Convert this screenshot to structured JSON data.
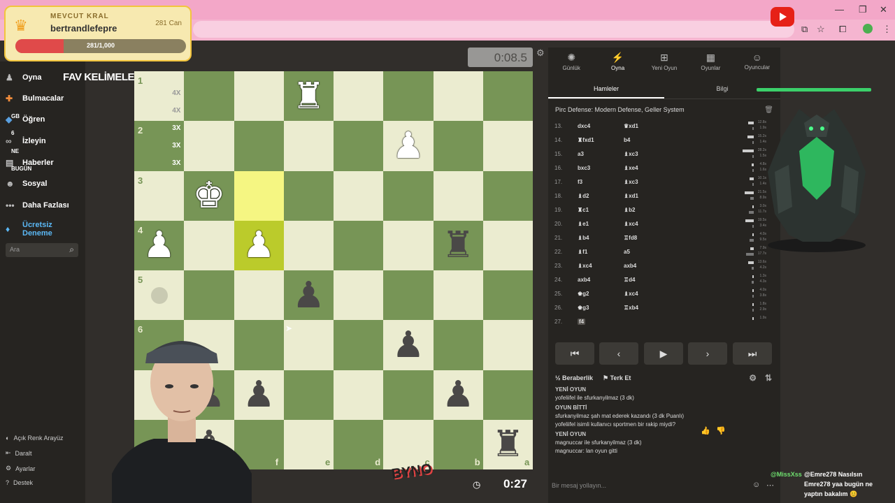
{
  "overlay_king": {
    "label": "MEVCUT KRAL",
    "name": "bertrandlefepre",
    "hp_label": "281 Can",
    "progress_text": "281/1,000",
    "progress_fraction": 0.281
  },
  "sidebar": {
    "items": [
      {
        "label": "Oyna",
        "icon": "pawn-icon"
      },
      {
        "label": "Bulmacalar",
        "icon": "puzzle-icon"
      },
      {
        "label": "Öğren",
        "icon": "learn-icon"
      },
      {
        "label": "İzleyin",
        "icon": "binoculars-icon"
      },
      {
        "label": "Haberler",
        "icon": "news-icon"
      },
      {
        "label": "Sosyal",
        "icon": "people-icon"
      },
      {
        "label": "Daha Fazlası",
        "icon": "dots-icon"
      },
      {
        "label": "Ücretsiz Deneme",
        "icon": "diamond-icon"
      }
    ],
    "search_placeholder": "Ara",
    "bottom": [
      {
        "label": "Açık Renk Arayüz",
        "icon": "theme-icon"
      },
      {
        "label": "Daralt",
        "icon": "collapse-icon"
      },
      {
        "label": "Ayarlar",
        "icon": "settings-icon"
      },
      {
        "label": "Destek",
        "icon": "help-icon"
      }
    ],
    "fav_words": "FAV KELİMELER",
    "side_labels": {
      "gb": "GB",
      "n6": "6",
      "ne": "NE",
      "bugun": "BUGÜN"
    }
  },
  "board": {
    "ranks": [
      "1",
      "2",
      "3",
      "4",
      "5",
      "6"
    ],
    "files": [
      "f",
      "e",
      "d",
      "c",
      "b",
      "a"
    ],
    "side_marks": [
      "4X",
      "4X",
      "3X",
      "3X",
      "3X"
    ],
    "top_clock": "0:08.5",
    "bottom_clock": "0:27"
  },
  "panel": {
    "tabs": [
      {
        "label": "Günlük",
        "icon": "sun-icon"
      },
      {
        "label": "Oyna",
        "icon": "lightning-icon"
      },
      {
        "label": "Yeni Oyun",
        "icon": "plus-icon"
      },
      {
        "label": "Oyunlar",
        "icon": "board-icon"
      },
      {
        "label": "Oyuncular",
        "icon": "players-icon"
      }
    ],
    "subtabs": [
      "Hamleler",
      "Bilgi"
    ],
    "opening": "Pirc Defense: Modern Defense, Geller System",
    "moves": [
      {
        "n": "13.",
        "w": "dxc4",
        "b": "♛xd1",
        "t1": "12.8s",
        "t2": "1.9s"
      },
      {
        "n": "14.",
        "w": "♜fxd1",
        "b": "b4",
        "t1": "15.2s",
        "t2": "1.4s"
      },
      {
        "n": "15.",
        "w": "a3",
        "b": "♝xc3",
        "t1": "28.2s",
        "t2": "1.5s"
      },
      {
        "n": "16.",
        "w": "bxc3",
        "b": "♝xe4",
        "t1": "4.8s",
        "t2": "1.6s"
      },
      {
        "n": "17.",
        "w": "f3",
        "b": "♝xc3",
        "t1": "10.1s",
        "t2": "1.4s"
      },
      {
        "n": "18.",
        "w": "♝d2",
        "b": "♝xd1",
        "t1": "21.5s",
        "t2": "8.9s"
      },
      {
        "n": "19.",
        "w": "♜c1",
        "b": "♝b2",
        "t1": "3.0s",
        "t2": "11.7s"
      },
      {
        "n": "20.",
        "w": "♝e1",
        "b": "♝xc4",
        "t1": "19.5s",
        "t2": "3.4s"
      },
      {
        "n": "21.",
        "w": "♝b4",
        "b": "♖fd8",
        "t1": "4.0s",
        "t2": "9.5s"
      },
      {
        "n": "22.",
        "w": "♝f1",
        "b": "a5",
        "t1": "7.9s",
        "t2": "17.7s"
      },
      {
        "n": "23.",
        "w": "♝xc4",
        "b": "axb4",
        "t1": "13.6s",
        "t2": "4.2s"
      },
      {
        "n": "24.",
        "w": "axb4",
        "b": "♖d4",
        "t1": "1.3s",
        "t2": "4.3s"
      },
      {
        "n": "25.",
        "w": "♚g2",
        "b": "♝xc4",
        "t1": "4.0s",
        "t2": "3.8s"
      },
      {
        "n": "26.",
        "w": "♚g3",
        "b": "♖xb4",
        "t1": "1.8s",
        "t2": "2.9s"
      },
      {
        "n": "27.",
        "w": "f4",
        "b": "",
        "t1": "1.9s",
        "t2": ""
      }
    ],
    "draw_label": "Beraberlik",
    "resign_label": "Terk Et",
    "chat": [
      {
        "type": "hdr",
        "text": "YENİ OYUN"
      },
      {
        "type": "line",
        "text": "yofeliifel ile sfurkanyilmaz (3 dk)"
      },
      {
        "type": "hdr",
        "text": "OYUN BİTTİ"
      },
      {
        "type": "line",
        "text": "sfurkanyilmaz şah mat ederek kazandı (3 dk Puanlı)"
      },
      {
        "type": "line",
        "text": "yofeliifel isimli kullanıcı sportmen bir rakip miydi?"
      },
      {
        "type": "hdr",
        "text": "YENİ OYUN"
      },
      {
        "type": "line",
        "text": "magnuccar ile sfurkanyilmaz (3 dk)"
      },
      {
        "type": "line",
        "text": "magnuccar: lan oyun gitti"
      }
    ],
    "chat_placeholder": "Bir mesaj yollayın..."
  },
  "stream_chat": {
    "user": "@MissXss",
    "lines": [
      "@Emre278 Nasılsın",
      "Emre278 yaa bugün ne",
      "yaptın bakalım 😊"
    ]
  },
  "sticker": "BYNO",
  "colors": {
    "light_square": "#ebecd0",
    "dark_square": "#779556",
    "highlight": "#f5f682",
    "accent_green": "#3bd06a"
  }
}
